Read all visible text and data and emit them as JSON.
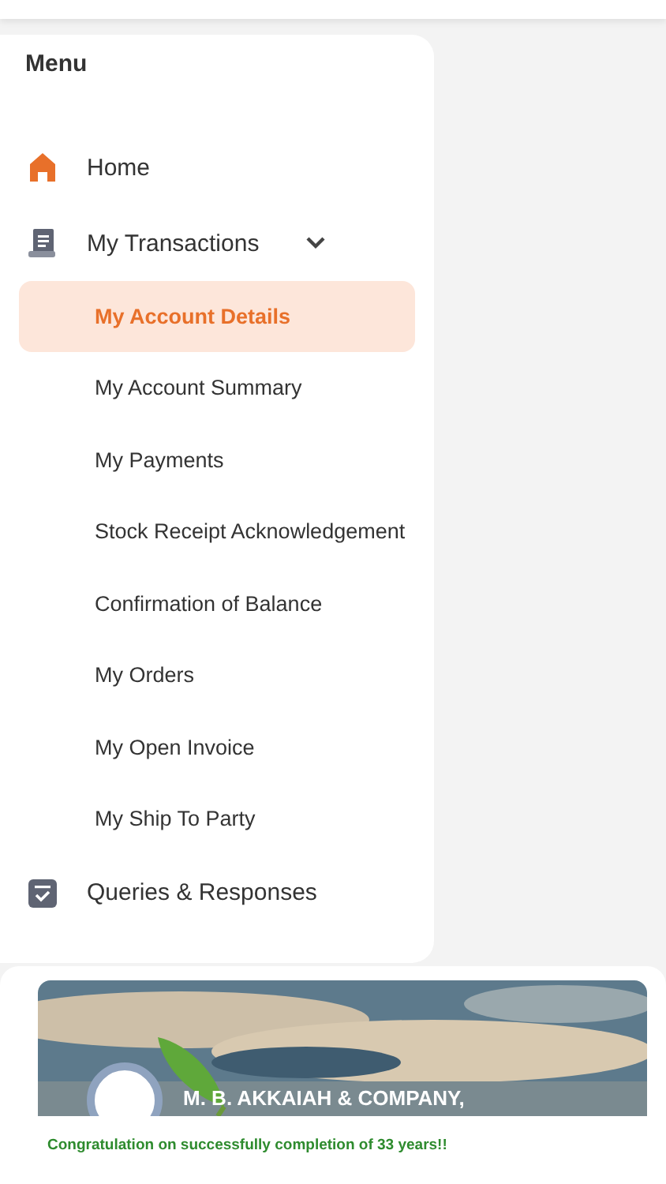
{
  "menu": {
    "title": "Menu",
    "items": [
      {
        "kind": "home",
        "label": "Home"
      },
      {
        "kind": "transactions",
        "label": "My Transactions",
        "expanded": true,
        "children": [
          {
            "label": "My Account Details",
            "selected": true
          },
          {
            "label": "My Account Summary",
            "selected": false
          },
          {
            "label": "My Payments",
            "selected": false
          },
          {
            "label": "Stock Receipt Acknowledgement",
            "selected": false
          },
          {
            "label": "Confirmation of Balance",
            "selected": false
          },
          {
            "label": "My Orders",
            "selected": false
          },
          {
            "label": "My Open Invoice",
            "selected": false
          },
          {
            "label": "My Ship To Party",
            "selected": false
          }
        ]
      },
      {
        "kind": "queries",
        "label": "Queries & Responses"
      }
    ]
  },
  "banner": {
    "company": "M. B. AKKAIAH & COMPANY,",
    "message": "Congratulation on successfully completion of 33 years!!"
  }
}
